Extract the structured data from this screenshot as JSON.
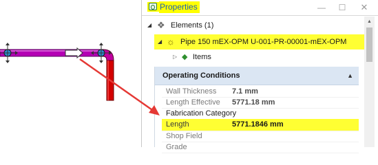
{
  "window": {
    "title": "Properties",
    "title_icon": "properties-window-icon",
    "minimize_icon": "minimize-icon",
    "maximize_icon": "maximize-icon",
    "close_icon": "close-icon"
  },
  "tree": {
    "elements": {
      "label": "Elements (1)",
      "icon": "elements-icon",
      "caret": "◢"
    },
    "pipe": {
      "label": "Pipe 150 mEX-OPM U-001-PR-00001-mEX-OPM",
      "icon": "pipe-sun-icon",
      "caret": "◢"
    },
    "items": {
      "label": "Items",
      "icon": "items-diamond-icon",
      "caret": "▷"
    }
  },
  "section": {
    "title": "Operating Conditions",
    "collapse_icon": "chevron-up-icon"
  },
  "properties": [
    {
      "name": "Wall Thickness",
      "value": "7.1 mm"
    },
    {
      "name": "Length Effective",
      "value": "5771.18 mm"
    },
    {
      "name": "Fabrication Category",
      "value": ""
    },
    {
      "name": "Length",
      "value": "5771.1846 mm"
    },
    {
      "name": "Shop Field",
      "value": ""
    },
    {
      "name": "Grade",
      "value": ""
    }
  ],
  "colors": {
    "pipe": "#b400b4",
    "pipe_vertical": "#d40000",
    "highlight": "#ffff33",
    "arrow": "#e53935",
    "section_header": "#dbe6f3",
    "title_text": "#1d5fb3"
  }
}
